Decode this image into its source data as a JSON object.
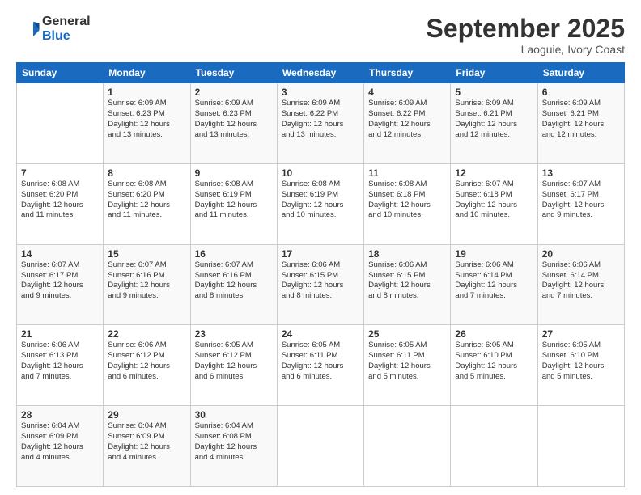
{
  "header": {
    "logo_general": "General",
    "logo_blue": "Blue",
    "month_title": "September 2025",
    "location": "Laoguie, Ivory Coast"
  },
  "days_of_week": [
    "Sunday",
    "Monday",
    "Tuesday",
    "Wednesday",
    "Thursday",
    "Friday",
    "Saturday"
  ],
  "weeks": [
    [
      {
        "day": "",
        "info": ""
      },
      {
        "day": "1",
        "info": "Sunrise: 6:09 AM\nSunset: 6:23 PM\nDaylight: 12 hours\nand 13 minutes."
      },
      {
        "day": "2",
        "info": "Sunrise: 6:09 AM\nSunset: 6:23 PM\nDaylight: 12 hours\nand 13 minutes."
      },
      {
        "day": "3",
        "info": "Sunrise: 6:09 AM\nSunset: 6:22 PM\nDaylight: 12 hours\nand 13 minutes."
      },
      {
        "day": "4",
        "info": "Sunrise: 6:09 AM\nSunset: 6:22 PM\nDaylight: 12 hours\nand 12 minutes."
      },
      {
        "day": "5",
        "info": "Sunrise: 6:09 AM\nSunset: 6:21 PM\nDaylight: 12 hours\nand 12 minutes."
      },
      {
        "day": "6",
        "info": "Sunrise: 6:09 AM\nSunset: 6:21 PM\nDaylight: 12 hours\nand 12 minutes."
      }
    ],
    [
      {
        "day": "7",
        "info": "Sunrise: 6:08 AM\nSunset: 6:20 PM\nDaylight: 12 hours\nand 11 minutes."
      },
      {
        "day": "8",
        "info": "Sunrise: 6:08 AM\nSunset: 6:20 PM\nDaylight: 12 hours\nand 11 minutes."
      },
      {
        "day": "9",
        "info": "Sunrise: 6:08 AM\nSunset: 6:19 PM\nDaylight: 12 hours\nand 11 minutes."
      },
      {
        "day": "10",
        "info": "Sunrise: 6:08 AM\nSunset: 6:19 PM\nDaylight: 12 hours\nand 10 minutes."
      },
      {
        "day": "11",
        "info": "Sunrise: 6:08 AM\nSunset: 6:18 PM\nDaylight: 12 hours\nand 10 minutes."
      },
      {
        "day": "12",
        "info": "Sunrise: 6:07 AM\nSunset: 6:18 PM\nDaylight: 12 hours\nand 10 minutes."
      },
      {
        "day": "13",
        "info": "Sunrise: 6:07 AM\nSunset: 6:17 PM\nDaylight: 12 hours\nand 9 minutes."
      }
    ],
    [
      {
        "day": "14",
        "info": "Sunrise: 6:07 AM\nSunset: 6:17 PM\nDaylight: 12 hours\nand 9 minutes."
      },
      {
        "day": "15",
        "info": "Sunrise: 6:07 AM\nSunset: 6:16 PM\nDaylight: 12 hours\nand 9 minutes."
      },
      {
        "day": "16",
        "info": "Sunrise: 6:07 AM\nSunset: 6:16 PM\nDaylight: 12 hours\nand 8 minutes."
      },
      {
        "day": "17",
        "info": "Sunrise: 6:06 AM\nSunset: 6:15 PM\nDaylight: 12 hours\nand 8 minutes."
      },
      {
        "day": "18",
        "info": "Sunrise: 6:06 AM\nSunset: 6:15 PM\nDaylight: 12 hours\nand 8 minutes."
      },
      {
        "day": "19",
        "info": "Sunrise: 6:06 AM\nSunset: 6:14 PM\nDaylight: 12 hours\nand 7 minutes."
      },
      {
        "day": "20",
        "info": "Sunrise: 6:06 AM\nSunset: 6:14 PM\nDaylight: 12 hours\nand 7 minutes."
      }
    ],
    [
      {
        "day": "21",
        "info": "Sunrise: 6:06 AM\nSunset: 6:13 PM\nDaylight: 12 hours\nand 7 minutes."
      },
      {
        "day": "22",
        "info": "Sunrise: 6:06 AM\nSunset: 6:12 PM\nDaylight: 12 hours\nand 6 minutes."
      },
      {
        "day": "23",
        "info": "Sunrise: 6:05 AM\nSunset: 6:12 PM\nDaylight: 12 hours\nand 6 minutes."
      },
      {
        "day": "24",
        "info": "Sunrise: 6:05 AM\nSunset: 6:11 PM\nDaylight: 12 hours\nand 6 minutes."
      },
      {
        "day": "25",
        "info": "Sunrise: 6:05 AM\nSunset: 6:11 PM\nDaylight: 12 hours\nand 5 minutes."
      },
      {
        "day": "26",
        "info": "Sunrise: 6:05 AM\nSunset: 6:10 PM\nDaylight: 12 hours\nand 5 minutes."
      },
      {
        "day": "27",
        "info": "Sunrise: 6:05 AM\nSunset: 6:10 PM\nDaylight: 12 hours\nand 5 minutes."
      }
    ],
    [
      {
        "day": "28",
        "info": "Sunrise: 6:04 AM\nSunset: 6:09 PM\nDaylight: 12 hours\nand 4 minutes."
      },
      {
        "day": "29",
        "info": "Sunrise: 6:04 AM\nSunset: 6:09 PM\nDaylight: 12 hours\nand 4 minutes."
      },
      {
        "day": "30",
        "info": "Sunrise: 6:04 AM\nSunset: 6:08 PM\nDaylight: 12 hours\nand 4 minutes."
      },
      {
        "day": "",
        "info": ""
      },
      {
        "day": "",
        "info": ""
      },
      {
        "day": "",
        "info": ""
      },
      {
        "day": "",
        "info": ""
      }
    ]
  ]
}
